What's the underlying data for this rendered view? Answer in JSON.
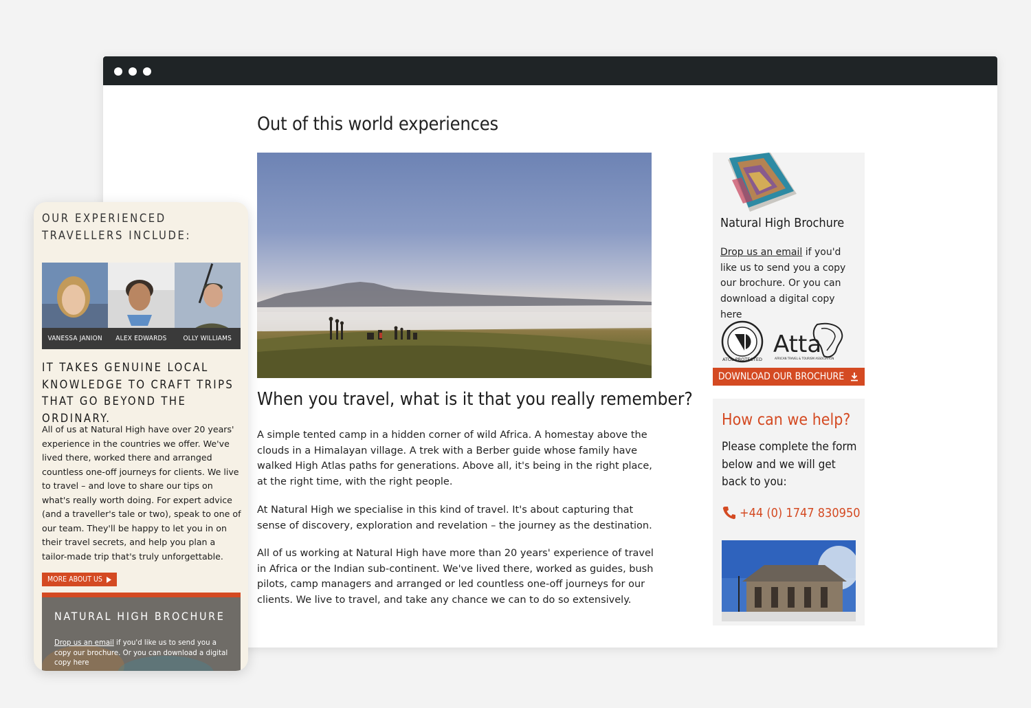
{
  "desktop": {
    "heading": "Out of this world experiences",
    "subheading": "When you travel, what is it that you really remember?",
    "paragraphs": [
      "A simple tented camp in a hidden corner of wild Africa. A homestay above the clouds in a Himalayan village. A trek with a Berber guide whose family have walked High Atlas paths for generations. Above all, it's being in the right place, at the right time, with the right people.",
      "At Natural High we specialise in this kind of travel. It's about capturing that sense of discovery, exploration and revelation – the journey as the destination.",
      "All of us working at Natural High have more than 20 years' experience of travel in Africa or the Indian sub-continent. We've lived there, worked as guides, bush pilots, camp managers and arranged or led countless one-off journeys for our clients. We live to travel, and take any chance we can to do so extensively."
    ],
    "sidebar": {
      "brochure_title": "Natural High Brochure",
      "brochure_link": "Drop us an email",
      "brochure_text": " if you'd like us to send you a copy our brochure. Or you can download a digital copy here",
      "atol_label": "ATOL PROTECTED",
      "atta_label": "Atta",
      "atta_sub": "AFRICAN TRAVEL & TOURISM ASSOCIATION",
      "download_button": "DOWNLOAD OUR BROCHURE",
      "help_title": "How can we help?",
      "help_text": "Please complete the form below and we will get back to you:",
      "phone": "+44 (0) 1747 830950"
    }
  },
  "mobile": {
    "heading": "OUR EXPERIENCED TRAVELLERS INCLUDE:",
    "team": [
      {
        "name": "VANESSA JANION"
      },
      {
        "name": "ALEX EDWARDS"
      },
      {
        "name": "OLLY WILLIAMS"
      }
    ],
    "subheading": "IT TAKES GENUINE LOCAL KNOWLEDGE TO CRAFT TRIPS THAT GO BEYOND THE ORDINARY.",
    "paragraph": "All of us at Natural High have over 20 years' experience in the countries we offer. We've lived there, worked there and arranged countless one-off journeys for clients. We live to travel – and love to share our tips on what's really worth doing. For expert advice (and a traveller's tale or two), speak to one of our team. They'll be happy to let you in on their travel secrets, and help you plan a tailor-made trip that's truly unforgettable.",
    "more_button": "MORE ABOUT US",
    "brochure_title": "NATURAL HIGH BROCHURE",
    "brochure_link": "Drop us an email",
    "brochure_text": " if you'd like us to send you a copy our brochure. Or you can download a digital copy here"
  },
  "colors": {
    "accent": "#d44a22",
    "titlebar": "#1f2426",
    "mobile_bg": "#f6f1e6",
    "sidebar_bg": "#f3f3f3"
  },
  "icons": [
    "window-dot-icon",
    "download-icon",
    "phone-icon",
    "play-arrow-icon"
  ]
}
